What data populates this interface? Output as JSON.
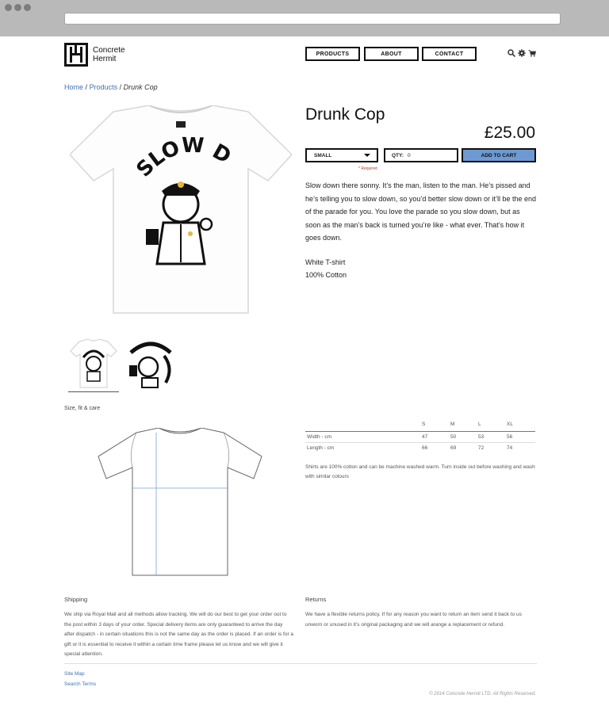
{
  "browser": {
    "dots": 3
  },
  "header": {
    "logo_line1": "Concrete",
    "logo_line2": "Hermit",
    "nav": [
      {
        "label": "PRODUCTS"
      },
      {
        "label": "ABOUT"
      },
      {
        "label": "CONTACT"
      }
    ],
    "icons": [
      "search-icon",
      "gear-icon",
      "cart-icon"
    ]
  },
  "breadcrumb": {
    "home": "Home",
    "products": "Products",
    "current": "Drunk Cop",
    "sep": "/"
  },
  "product": {
    "title": "Drunk Cop",
    "price": "£25.00",
    "size_selected": "SMALL",
    "required": "* Required",
    "qty_label": "QTY:",
    "qty_value": "0",
    "add_to_cart": "ADD TO CART",
    "description": "Slow down there sonny. It’s the man, listen to the man. He’s pissed and he’s telling you to slow down, so you’d better slow down or it’ll be the end of the parade for you. You love the parade so you slow down, but as soon as the man’s back is turned you’re like - what ever. That’s how it goes down.",
    "spec1": "White T-shirt",
    "spec2": "100% Cotton",
    "shirt_text": "SLOW DOWN N!"
  },
  "size_fit": {
    "title": "Size, fit & care",
    "columns": [
      "S",
      "M",
      "L",
      "XL"
    ],
    "rows": [
      {
        "label": "Width - cm",
        "values": [
          "47",
          "50",
          "53",
          "56"
        ]
      },
      {
        "label": "Length - cm",
        "values": [
          "66",
          "69",
          "72",
          "74"
        ]
      }
    ],
    "care": "Shirts are 100% cotton and can be machine washed warm. Turn inside out before washing and wash with similar colours"
  },
  "shipping": {
    "title": "Shipping",
    "body": "We ship via Royal Mail and all methods allow tracking. We will do our best to get your order out to the post within 3 days of your order. Special delivery items are only guaranteed to arrive the day after dispatch - in certain situations this is not the same day as the order is placed. If an order is for a gift or it is essential to receive it within a certain time frame please let us know and we will give it special attention."
  },
  "returns": {
    "title": "Returns",
    "body": "We have a flexible returns policy. If for any reason you want to return an item send it back to us unworn or unused in it’s original packaging and we will arange a replacement or refund."
  },
  "footer": {
    "links": [
      "Site Map",
      "Search Terms"
    ],
    "copyright": "© 2014 Concrete Hermit LTD. All Rights Reserved."
  },
  "colors": {
    "link": "#3f73b5",
    "add_to_cart": "#6d9ad3",
    "required": "#c0392b"
  }
}
